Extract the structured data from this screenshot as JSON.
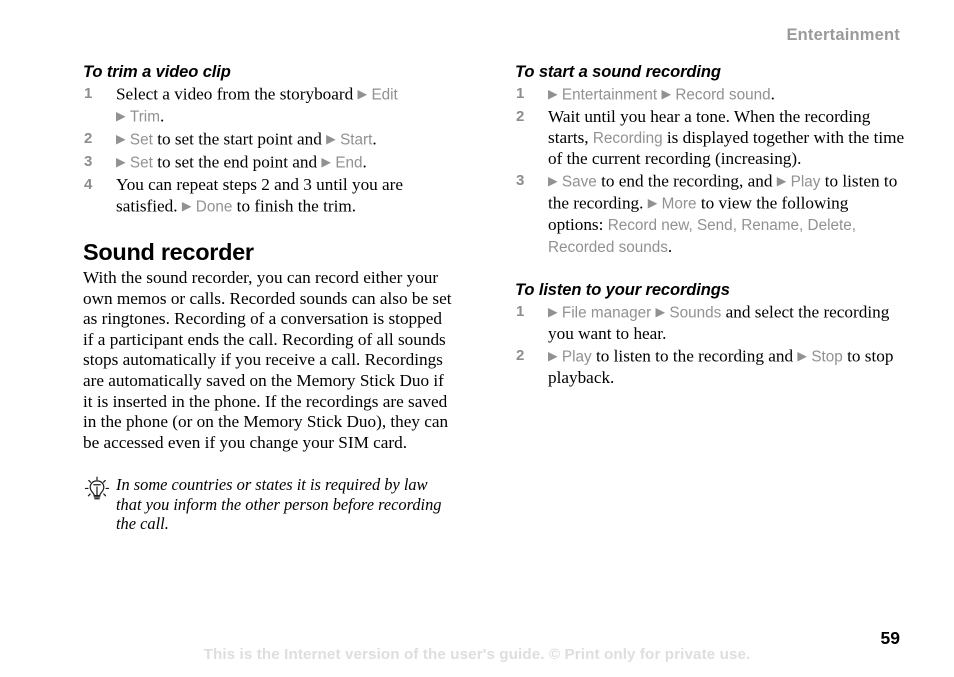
{
  "header": {
    "running_title": "Entertainment"
  },
  "icons": {
    "tip": "lightbulb-icon",
    "menu_arrow": "▶"
  },
  "left_column": {
    "procedure": {
      "title": "To trim a video clip",
      "steps": [
        {
          "number": "1",
          "line1_text": "Select a video from the storyboard ",
          "line1_arrow": "▶",
          "line1_ui": "Edit",
          "line2_arrow": "▶",
          "line2_ui": "Trim",
          "line2_tail": "."
        },
        {
          "number": "2",
          "arrow1": "▶",
          "ui1": "Set",
          "mid": " to set the start point and ",
          "arrow2": "▶",
          "ui2": "Start",
          "tail": "."
        },
        {
          "number": "3",
          "arrow1": "▶",
          "ui1": "Set",
          "mid": " to set the end point and ",
          "arrow2": "▶",
          "ui2": "End",
          "tail": "."
        },
        {
          "number": "4",
          "text_before": "You can repeat steps 2 and 3 until you are satisfied. ",
          "arrow": "▶",
          "ui": "Done",
          "text_after": " to finish the trim."
        }
      ]
    },
    "section": {
      "title": "Sound recorder",
      "paragraph": "With the sound recorder, you can record either your own memos or calls. Recorded sounds can also be set as ringtones. Recording of a conversation is stopped if a participant ends the call. Recording of all sounds stops automatically if you receive a call. Recordings are automatically saved on the Memory Stick Duo if it is inserted in the phone. If the recordings are saved in the phone (or on the Memory Stick Duo), they can be accessed even if you change your SIM card."
    },
    "tip": {
      "text": "In some countries or states it is required by law that you inform the other person before recording the call."
    }
  },
  "right_column": {
    "procedure_start": {
      "title": "To start a sound recording",
      "steps": [
        {
          "number": "1",
          "arrow1": "▶",
          "ui1": "Entertainment",
          "mid": " ",
          "arrow2": "▶",
          "ui2": "Record sound",
          "tail": "."
        },
        {
          "number": "2",
          "text_before": "Wait until you hear a tone. When the recording starts, ",
          "ui": "Recording",
          "text_after": " is displayed together with the time of the current recording (increasing)."
        },
        {
          "number": "3",
          "arrow1": "▶",
          "ui1": "Save",
          "t1": " to end the recording, and ",
          "arrow2": "▶",
          "ui2": "Play",
          "t2": " to listen to the recording. ",
          "arrow3": "▶",
          "ui3": "More",
          "t3": " to view the following options: ",
          "opt1": "Record new",
          "opt2": "Send",
          "opt3": "Rename",
          "opt4": "Delete",
          "opt5": "Recorded sounds",
          "tail": "."
        }
      ]
    },
    "procedure_listen": {
      "title": "To listen to your recordings",
      "steps": [
        {
          "number": "1",
          "arrow1": "▶",
          "ui1": "File manager",
          "mid": " ",
          "arrow2": "▶",
          "ui2": "Sounds",
          "tail": " and select the recording you want to hear."
        },
        {
          "number": "2",
          "arrow1": "▶",
          "ui1": "Play",
          "mid": " to listen to the recording and ",
          "arrow2": "▶",
          "ui2": "Stop",
          "tail": " to stop playback."
        }
      ]
    }
  },
  "footer": {
    "note": "This is the Internet version of the user's guide. © Print only for private use.",
    "page_number": "59"
  },
  "colors": {
    "ui_term_gray": "#919191",
    "header_gray": "#9a9a9a",
    "step_number_gray": "#8d8d8d",
    "footer_gray": "#dedede",
    "text_black": "#000000"
  }
}
